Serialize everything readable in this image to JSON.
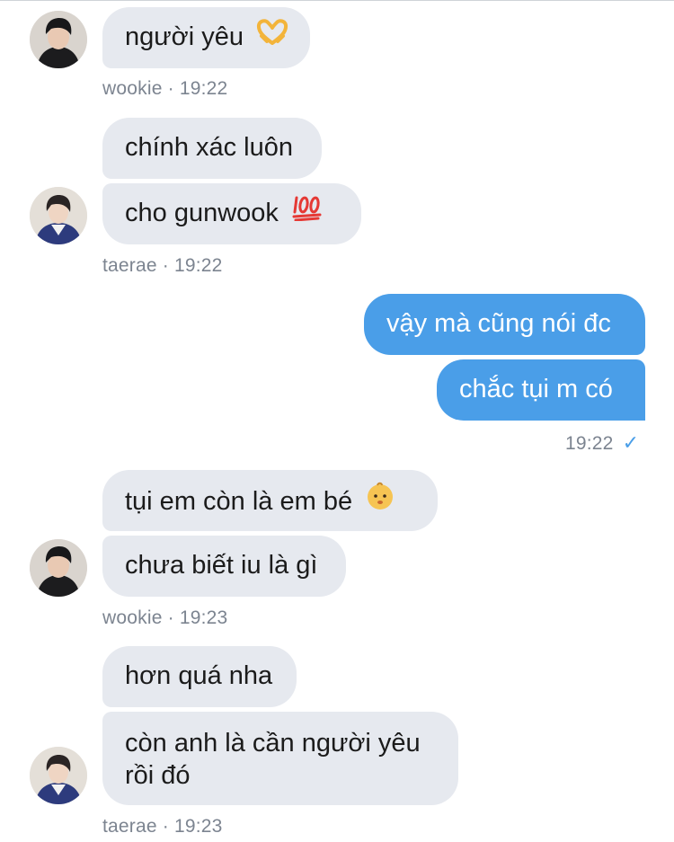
{
  "conversation": {
    "group1": {
      "sender": "wookie",
      "messages": [
        "người yêu"
      ],
      "emoji": "heart-hands-emoji",
      "meta": "wookie · 19:22"
    },
    "group2": {
      "sender": "taerae",
      "messages": [
        "chính xác luôn",
        "cho gunwook"
      ],
      "emoji": "hundred-points-emoji",
      "meta": "taerae · 19:22"
    },
    "group3": {
      "sender": "me",
      "messages": [
        "vậy mà cũng nói đc",
        "chắc tụi m có"
      ],
      "meta": "19:22",
      "read_mark": "✓"
    },
    "group4": {
      "sender": "wookie",
      "messages": [
        "tụi em còn là em bé",
        "chưa biết iu là gì"
      ],
      "emoji": "baby-emoji",
      "meta": "wookie · 19:23"
    },
    "group5": {
      "sender": "taerae",
      "messages": [
        "hơn quá nha",
        "còn anh là cần người yêu rồi đó"
      ],
      "meta": "taerae · 19:23"
    }
  },
  "colors": {
    "incoming_bubble": "#e6e9ef",
    "outgoing_bubble": "#4a9ee8",
    "meta_text": "#7c8490"
  }
}
